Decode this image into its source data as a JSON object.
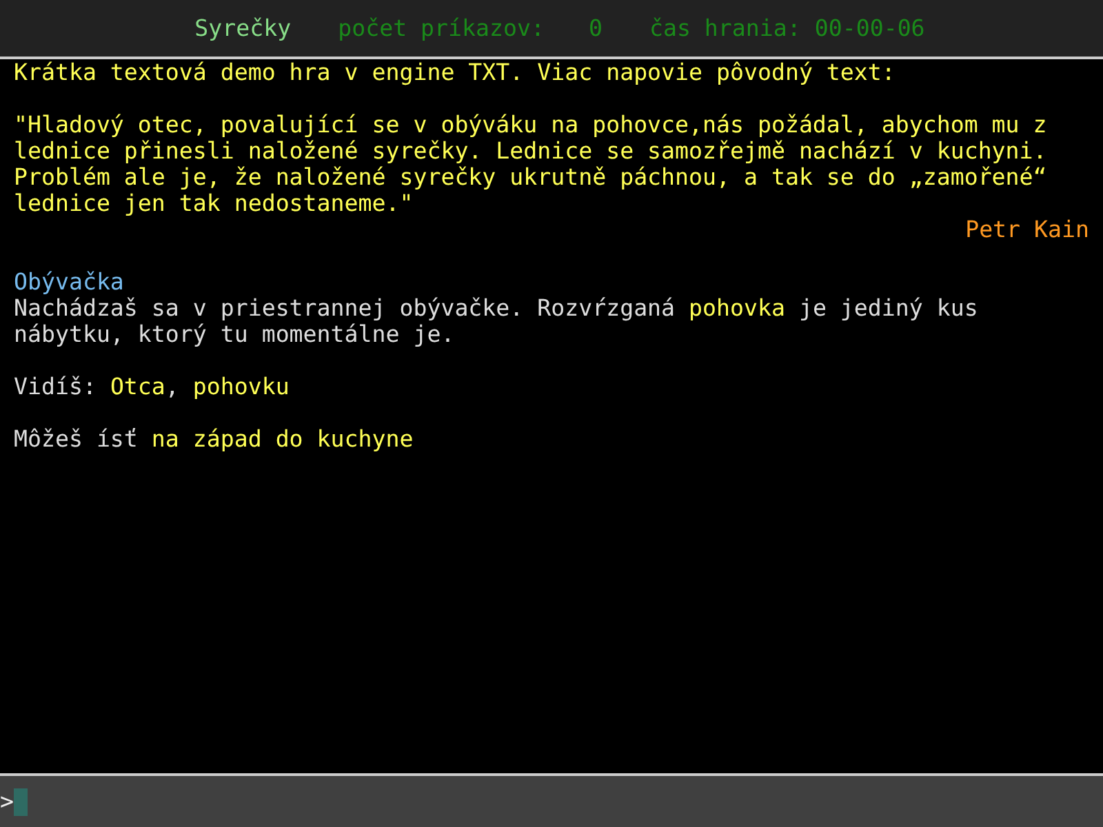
{
  "header": {
    "title": "Syrečky",
    "commands_label": "počet príkazov:",
    "commands_value": "0",
    "time_label": "čas hrania:",
    "time_value": "00-00-06"
  },
  "output": [
    {
      "kind": "intro",
      "text": "Krátka textová demo hra v engine TXT. Viac napovie pôvodný text:"
    },
    {
      "kind": "intro",
      "text": "\"Hladový otec, povalující se v obýváku na pohovce,nás požádal, abychom mu z lednice přinesli naložené syrečky. Lednice se samozřejmě nachází v kuchyni. Problém ale je, že naložené syrečky ukrutně páchnou, a tak se do „zamořené“ lednice jen tak nedostaneme.\""
    },
    {
      "kind": "author",
      "text": "Petr Kain"
    },
    {
      "kind": "room",
      "text": "Obývačka"
    },
    {
      "kind": "text",
      "segments": [
        {
          "text": "Nachádzaš sa v priestrannej obývačke. Rozvŕzganá ",
          "highlight": false
        },
        {
          "text": "pohovka",
          "highlight": true
        },
        {
          "text": " je jediný kus nábytku, ktorý tu momentálne je.",
          "highlight": false
        }
      ]
    },
    {
      "kind": "text",
      "segments": [
        {
          "text": "Vidíš: ",
          "highlight": false
        },
        {
          "text": "Otca",
          "highlight": true
        },
        {
          "text": ", ",
          "highlight": false
        },
        {
          "text": "pohovku",
          "highlight": true
        }
      ]
    },
    {
      "kind": "text",
      "segments": [
        {
          "text": "Môžeš ísť ",
          "highlight": false
        },
        {
          "text": "na západ do kuchyne",
          "highlight": true
        }
      ]
    }
  ],
  "prompt": {
    "symbol": ">"
  }
}
